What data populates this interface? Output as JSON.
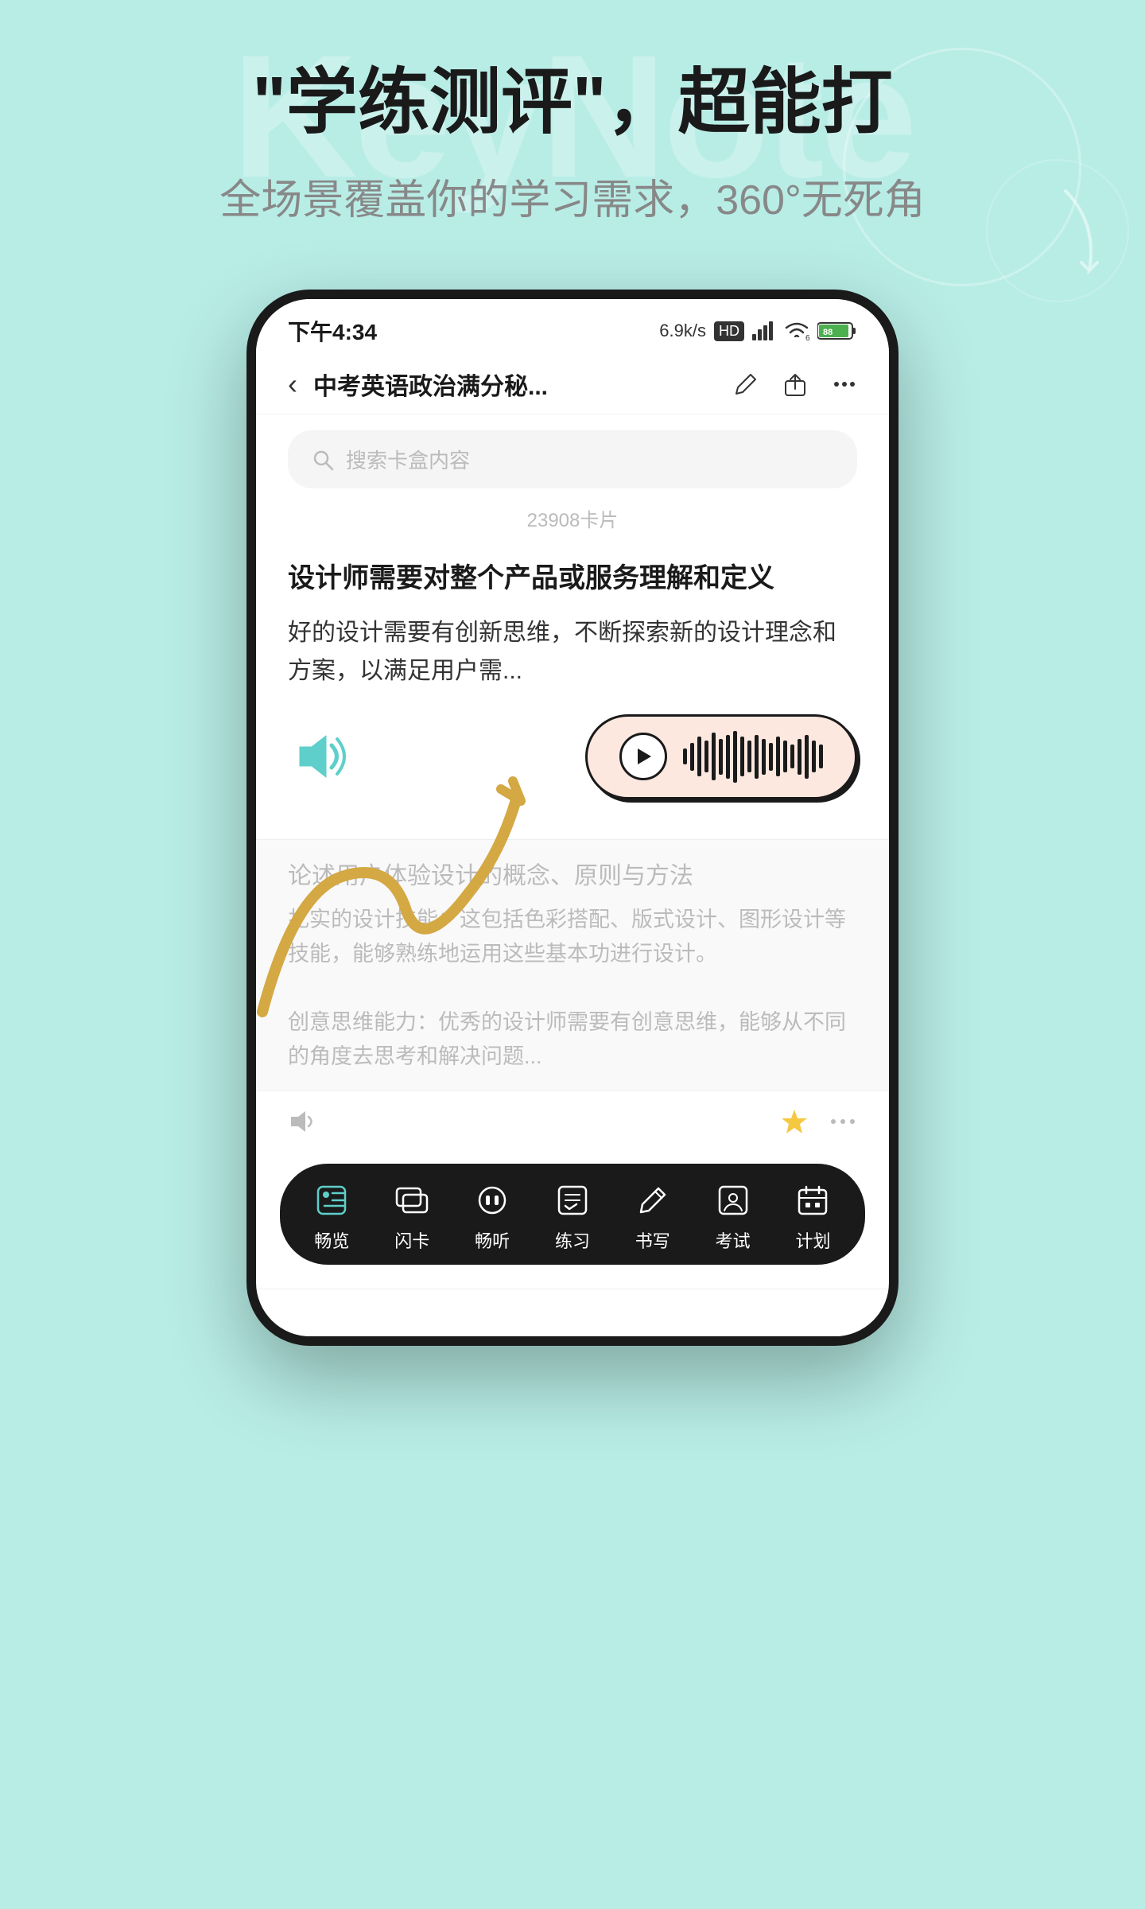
{
  "background": {
    "color": "#b8ede6",
    "watermark_text": "KeyNote"
  },
  "headline": {
    "main": "\"学练测评\"，超能打",
    "sub": "全场景覆盖你的学习需求，360°无死角"
  },
  "phone": {
    "status_bar": {
      "time": "下午4:34",
      "speed": "6.9k/s",
      "hd_badge": "HD",
      "signal": "信号",
      "wifi": "WiFi",
      "battery": "88"
    },
    "nav": {
      "back_label": "‹",
      "title": "中考英语政治满分秘...",
      "edit_icon": "edit",
      "share_icon": "share",
      "more_icon": "..."
    },
    "search": {
      "placeholder": "搜索卡盒内容"
    },
    "card_count": "23908卡片",
    "card": {
      "front_title": "设计师需要对整个产品或服务理解和定义",
      "front_body": "好的设计需要有创新思维，不断探索新的设计理念和方案，以满足用户需...",
      "back_title": "论述用户体验设计的概念、原则与方法",
      "back_body_1": "扎实的设计技能：这包括色彩搭配、版式设计、图形设计等技能，能够熟练地运用这些基本功进行设计。",
      "back_body_2": "创意思维能力：优秀的设计师需要有创意思维，能够从不同的角度去思考和解决问题..."
    },
    "audio_player": {
      "state": "playing",
      "waveform_heights": [
        20,
        35,
        50,
        40,
        60,
        45,
        55,
        65,
        50,
        40,
        55,
        45,
        35,
        50,
        40,
        30,
        45,
        55,
        40,
        30
      ]
    },
    "bottom_nav": {
      "items": [
        {
          "label": "畅览",
          "icon": "browse"
        },
        {
          "label": "闪卡",
          "icon": "flashcard"
        },
        {
          "label": "畅听",
          "icon": "listen"
        },
        {
          "label": "练习",
          "icon": "practice"
        },
        {
          "label": "书写",
          "icon": "write"
        },
        {
          "label": "考试",
          "icon": "exam"
        },
        {
          "label": "计划",
          "icon": "plan"
        }
      ]
    }
  }
}
